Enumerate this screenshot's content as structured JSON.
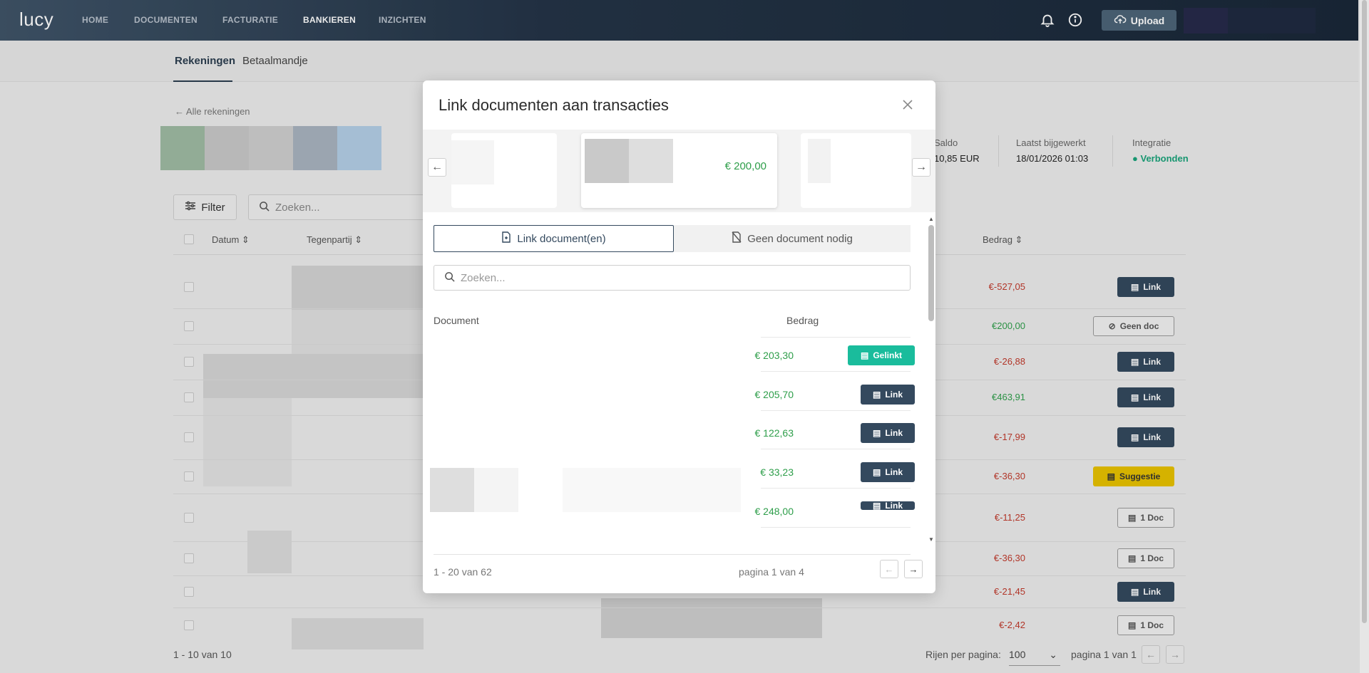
{
  "app": {
    "logo": "lucy"
  },
  "nav": {
    "items": [
      {
        "label": "HOME"
      },
      {
        "label": "DOCUMENTEN"
      },
      {
        "label": "FACTURATIE"
      },
      {
        "label": "BANKIEREN"
      },
      {
        "label": "INZICHTEN"
      }
    ],
    "upload_label": "Upload"
  },
  "subnav": {
    "tabs": [
      {
        "label": "Rekeningen"
      },
      {
        "label": "Betaalmandje"
      }
    ]
  },
  "account": {
    "back_label": "Alle rekeningen",
    "meta": [
      {
        "label": "Saldo",
        "value": "10,85 EUR"
      },
      {
        "label": "Laatst bijgewerkt",
        "value": "18/01/2026 01:03"
      },
      {
        "label": "Integratie",
        "value": "Verbonden"
      }
    ]
  },
  "toolbar": {
    "filter_label": "Filter",
    "search_placeholder": "Zoeken..."
  },
  "table": {
    "headers": {
      "date": "Datum",
      "counterparty": "Tegenpartij",
      "amount": "Bedrag"
    },
    "rows": [
      {
        "amount": "€-527,05",
        "action": "Link"
      },
      {
        "amount": "€200,00",
        "action": "Geen doc"
      },
      {
        "amount": "€-26,88",
        "action": "Link"
      },
      {
        "amount": "€463,91",
        "action": "Link"
      },
      {
        "amount": "€-17,99",
        "action": "Link"
      },
      {
        "amount": "€-36,30",
        "action": "Suggestie"
      },
      {
        "amount": "€-11,25",
        "action": "1 Doc"
      },
      {
        "amount": "€-36,30",
        "action": "1 Doc"
      },
      {
        "amount": "€-21,45",
        "action": "Link"
      },
      {
        "amount": "€-2,42",
        "action": "1 Doc"
      }
    ],
    "count_text": "1 - 10 van 10",
    "rows_per_page_label": "Rijen per pagina:",
    "rows_per_page_value": "100",
    "page_text": "pagina 1 van 1"
  },
  "modal": {
    "title": "Link documenten aan transacties",
    "carousel_selected_amount": "€ 200,00",
    "tab_link": "Link document(en)",
    "tab_none": "Geen document nodig",
    "search_placeholder": "Zoeken...",
    "col_document": "Document",
    "col_amount": "Bedrag",
    "docs": [
      {
        "amount": "€ 203,30",
        "action": "Gelinkt"
      },
      {
        "amount": "€ 205,70",
        "action": "Link"
      },
      {
        "amount": "€ 122,63",
        "action": "Link"
      },
      {
        "amount": "€ 33,23",
        "action": "Link"
      },
      {
        "amount": "€ 248,00",
        "action": "Link"
      }
    ],
    "count_text": "1 - 20 van 62",
    "page_text": "pagina 1 van 4"
  },
  "colors": {
    "nav_bg": "#243447",
    "accent_dark": "#34495e",
    "teal": "#1abc9c",
    "positive": "#2e9e4a",
    "negative": "#c0392b",
    "suggest": "#e8c200"
  }
}
